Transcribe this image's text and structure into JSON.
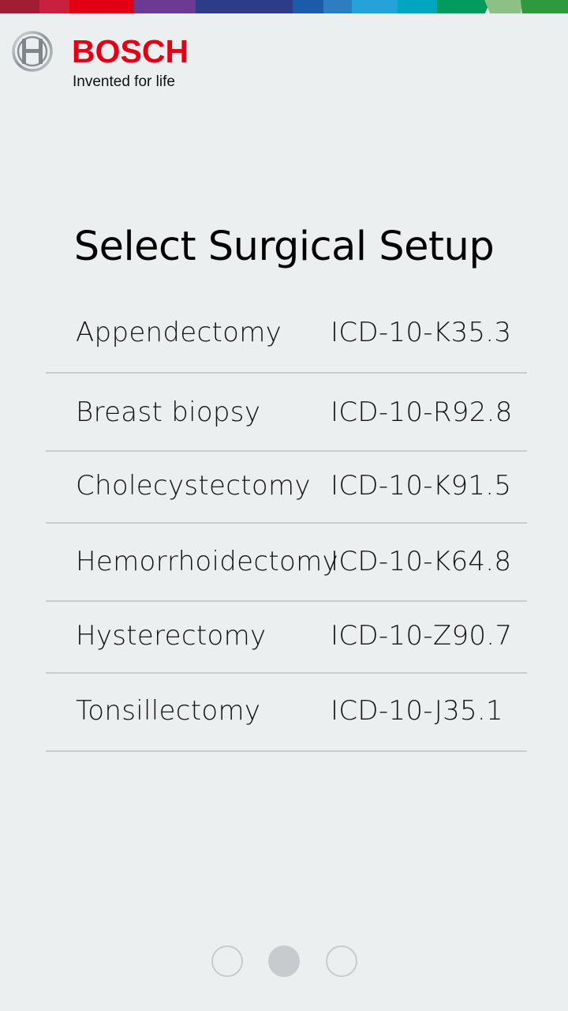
{
  "header": {
    "brand_name": "BOSCH",
    "tagline": "Invented for life",
    "supergraphic_colors": [
      "#a01d34",
      "#c8203d",
      "#e20015",
      "#72388f",
      "#4d3d8f",
      "#2a3f8a",
      "#1c4f9c",
      "#2d7ec0",
      "#23a3d8",
      "#00a8b0",
      "#009b5d",
      "#8cc084",
      "#2f9a3d"
    ],
    "brand_color": "#e20015"
  },
  "main": {
    "title": "Select Surgical Setup",
    "setups": [
      {
        "name": "Appendectomy",
        "code": "ICD-10-K35.3"
      },
      {
        "name": "Breast biopsy",
        "code": "ICD-10-R92.8"
      },
      {
        "name": "Cholecystectomy",
        "code": "ICD-10-K91.5"
      },
      {
        "name": "Hemorrhoidectomy",
        "code": "ICD-10-K64.8"
      },
      {
        "name": "Hysterectomy",
        "code": "ICD-10-Z90.7"
      },
      {
        "name": "Tonsillectomy",
        "code": "ICD-10-J35.1"
      }
    ]
  },
  "pager": {
    "page_count": 3,
    "current_page": 2
  }
}
